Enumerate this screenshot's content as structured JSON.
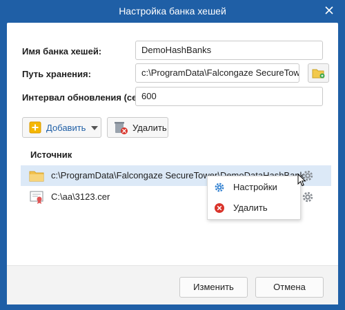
{
  "window": {
    "title": "Настройка банка хешей"
  },
  "form": {
    "name_label": "Имя банка хешей:",
    "name_value": "DemoHashBanks",
    "path_label": "Путь хранения:",
    "path_value": "c:\\ProgramData\\Falcongaze SecureTower\\",
    "interval_label": "Интервал обновления (сек):",
    "interval_value": "600"
  },
  "toolbar": {
    "add_label": "Добавить",
    "delete_label": "Удалить"
  },
  "sources": {
    "header": "Источник",
    "rows": [
      {
        "path": "c:\\ProgramData\\Falcongaze SecureTower\\DemoDataHashBank",
        "icon": "folder-icon"
      },
      {
        "path": "C:\\aa\\3123.cer",
        "icon": "certificate-icon"
      }
    ]
  },
  "context_menu": {
    "items": [
      {
        "label": "Настройки",
        "icon": "gear-icon"
      },
      {
        "label": "Удалить",
        "icon": "delete-icon"
      }
    ]
  },
  "footer": {
    "change_label": "Изменить",
    "cancel_label": "Отмена"
  },
  "colors": {
    "titlebar": "#1f5fa6",
    "selection": "#dce9f7",
    "add_icon": "#f5b700",
    "delete_icon": "#d9342b"
  }
}
